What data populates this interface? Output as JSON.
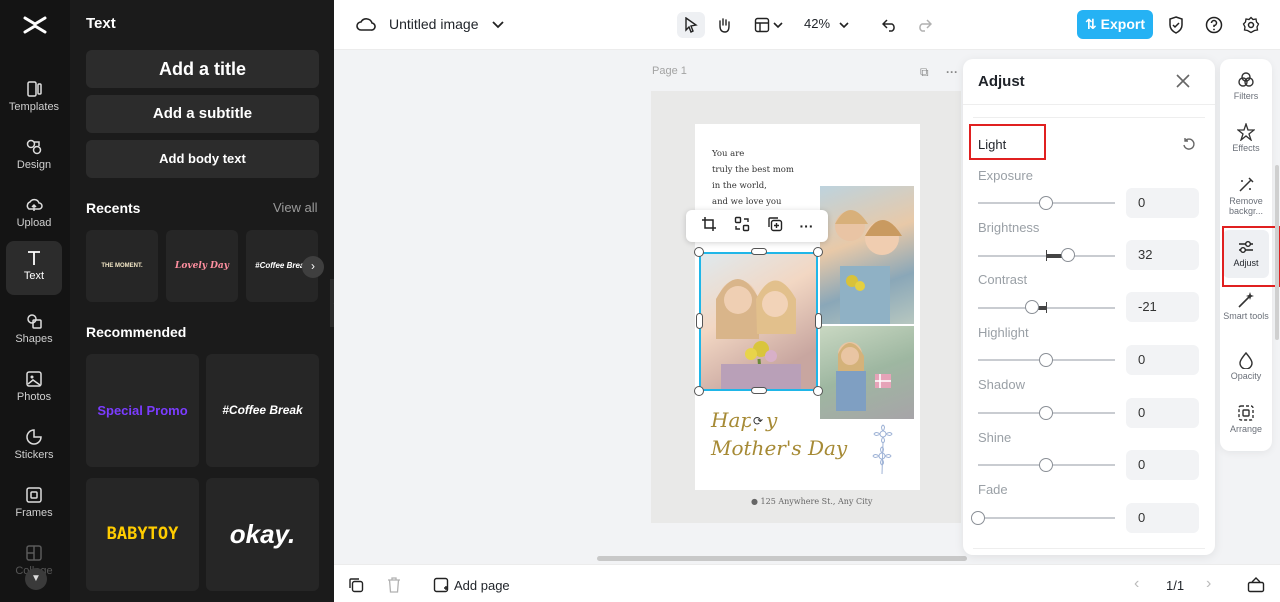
{
  "rail": {
    "items": [
      {
        "label": "Templates",
        "icon": "templates-icon"
      },
      {
        "label": "Design",
        "icon": "design-icon"
      },
      {
        "label": "Upload",
        "icon": "upload-icon"
      },
      {
        "label": "Text",
        "icon": "text-icon",
        "active": true
      },
      {
        "label": "Shapes",
        "icon": "shapes-icon"
      },
      {
        "label": "Photos",
        "icon": "photos-icon"
      },
      {
        "label": "Stickers",
        "icon": "stickers-icon"
      },
      {
        "label": "Frames",
        "icon": "frames-icon"
      },
      {
        "label": "Collage",
        "icon": "collage-icon"
      }
    ]
  },
  "text_panel": {
    "title": "Text",
    "add_title": "Add a title",
    "add_subtitle": "Add a subtitle",
    "add_body": "Add body text",
    "recents_label": "Recents",
    "view_all": "View all",
    "recents": [
      "THE MOMENT.",
      "Lovely Day",
      "#Coffee Break"
    ],
    "recommended_label": "Recommended",
    "recommended": [
      "Special Promo",
      "#Coffee Break",
      "BABYTOY",
      "okay."
    ]
  },
  "topbar": {
    "doc_title": "Untitled image",
    "zoom": "42%",
    "export_label": "Export"
  },
  "canvas": {
    "page_label": "Page 1",
    "poster_message": [
      "You are",
      "truly the best mom",
      "in the world,",
      "and we love you"
    ],
    "happy_line1": "Happy",
    "happy_line2": "Mother's Day",
    "address": "125 Anywhere St., Any City"
  },
  "adjust": {
    "title": "Adjust",
    "section": "Light",
    "sliders": [
      {
        "label": "Exposure",
        "value": "0"
      },
      {
        "label": "Brightness",
        "value": "32"
      },
      {
        "label": "Contrast",
        "value": "-21"
      },
      {
        "label": "Highlight",
        "value": "0"
      },
      {
        "label": "Shadow",
        "value": "0"
      },
      {
        "label": "Shine",
        "value": "0"
      },
      {
        "label": "Fade",
        "value": "0"
      }
    ]
  },
  "tools": [
    {
      "label": "Filters",
      "icon": "filters-icon"
    },
    {
      "label": "Effects",
      "icon": "effects-icon"
    },
    {
      "label": "Remove backgr...",
      "icon": "remove-background-icon"
    },
    {
      "label": "Adjust",
      "icon": "adjust-icon",
      "active": true
    },
    {
      "label": "Smart tools",
      "icon": "smart-tools-icon"
    },
    {
      "label": "Opacity",
      "icon": "opacity-icon"
    },
    {
      "label": "Arrange",
      "icon": "arrange-icon"
    }
  ],
  "bottombar": {
    "add_page": "Add page",
    "page_indicator": "1/1"
  },
  "colors": {
    "accent": "#25b2f4",
    "selection": "#1fb6e8",
    "highlight_box": "#e02020",
    "panel_bg": "#1b1b1b"
  }
}
